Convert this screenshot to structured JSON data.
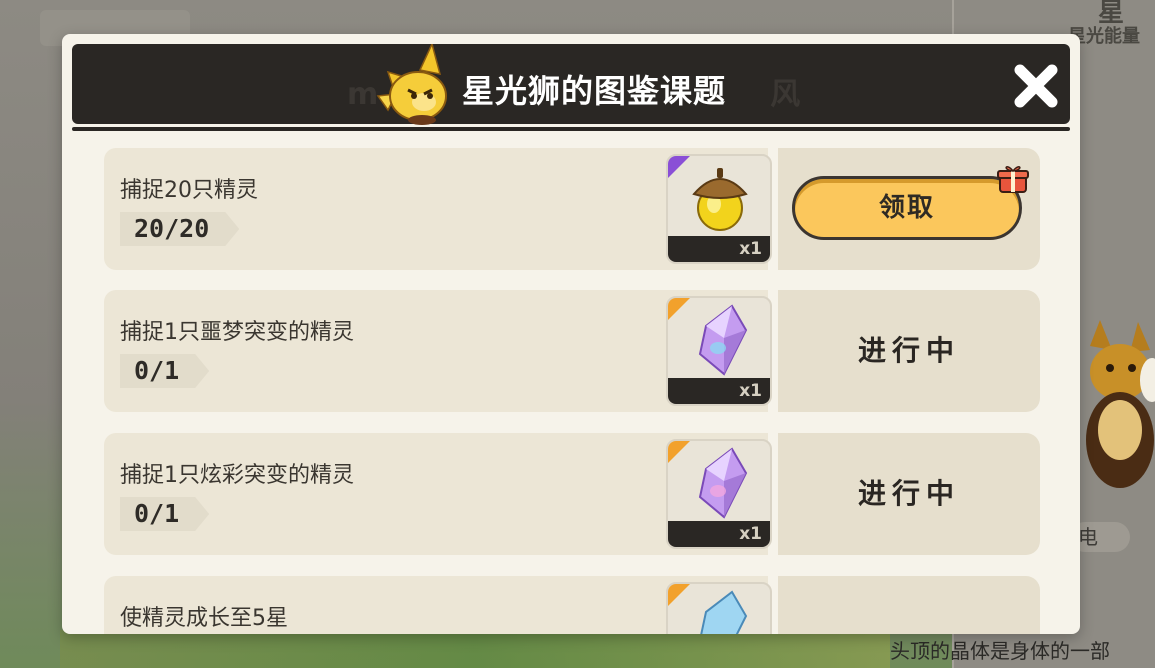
{
  "modal": {
    "title": "星光狮的图鉴课题",
    "watermark_left": "m",
    "watermark_right": "风"
  },
  "quests": [
    {
      "title": "捕捉20只精灵",
      "progress": "20/20",
      "reward_icon": "acorn-icon",
      "reward_qty": "x1",
      "action": "领取",
      "action_type": "claim",
      "rarity_color": "#8a4fd6"
    },
    {
      "title": "捕捉1只噩梦突变的精灵",
      "progress": "0/1",
      "reward_icon": "crystal-icon",
      "reward_qty": "x1",
      "action": "进行中",
      "action_type": "status",
      "rarity_color": "#f2a12c"
    },
    {
      "title": "捕捉1只炫彩突变的精灵",
      "progress": "0/1",
      "reward_icon": "crystal-icon",
      "reward_qty": "x1",
      "action": "进行中",
      "action_type": "status",
      "rarity_color": "#f2a12c"
    },
    {
      "title": "使精灵成长至5星",
      "progress": "",
      "reward_icon": "crystal-icon",
      "reward_qty": "",
      "action": "",
      "action_type": "status",
      "rarity_color": "#f2a12c"
    }
  ],
  "background": {
    "right_title": "星",
    "right_subtitle": "星光能量",
    "right_tag": "电",
    "caption": "头顶的晶体是身体的一部"
  },
  "colors": {
    "header": "#2a2724",
    "claim_button": "#fbc75c",
    "panel": "#f6f3ea"
  }
}
